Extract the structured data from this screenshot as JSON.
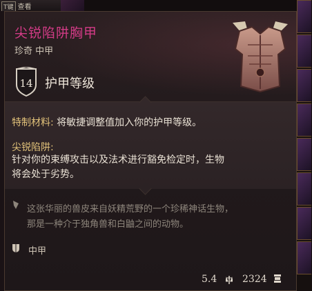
{
  "hud": {
    "key_label": "T键",
    "view_label": "查看"
  },
  "item": {
    "name": "尖锐陷阱胸甲",
    "rarity_type": "珍奇 中甲",
    "armor_class": "14",
    "armor_label": "护甲等级",
    "colors": {
      "rarity": "#d23b86",
      "property_title": "#e2c27a"
    }
  },
  "properties": {
    "special_material_title": "特制材料:",
    "special_material_text": " 将敏捷调整值加入你的护甲等级。",
    "trap_title": "尖锐陷阱:",
    "trap_text_line1": "针对你的束缚攻击以及法术进行豁免检定时，生物",
    "trap_text_line2": "将会处于劣势。"
  },
  "lore": {
    "line1": "这张华丽的兽皮来自妖精荒野的一个珍稀神话生物，",
    "line2": "那是一种介于独角兽和白鼬之间的动物。"
  },
  "footer": {
    "category": "中甲",
    "weight": "5.4",
    "price": "2324"
  },
  "icons": {
    "armor_badge": "shield-icon",
    "lore": "quill-icon",
    "category": "armor-category-icon",
    "weight": "weight-icon",
    "price": "coin-icon"
  }
}
